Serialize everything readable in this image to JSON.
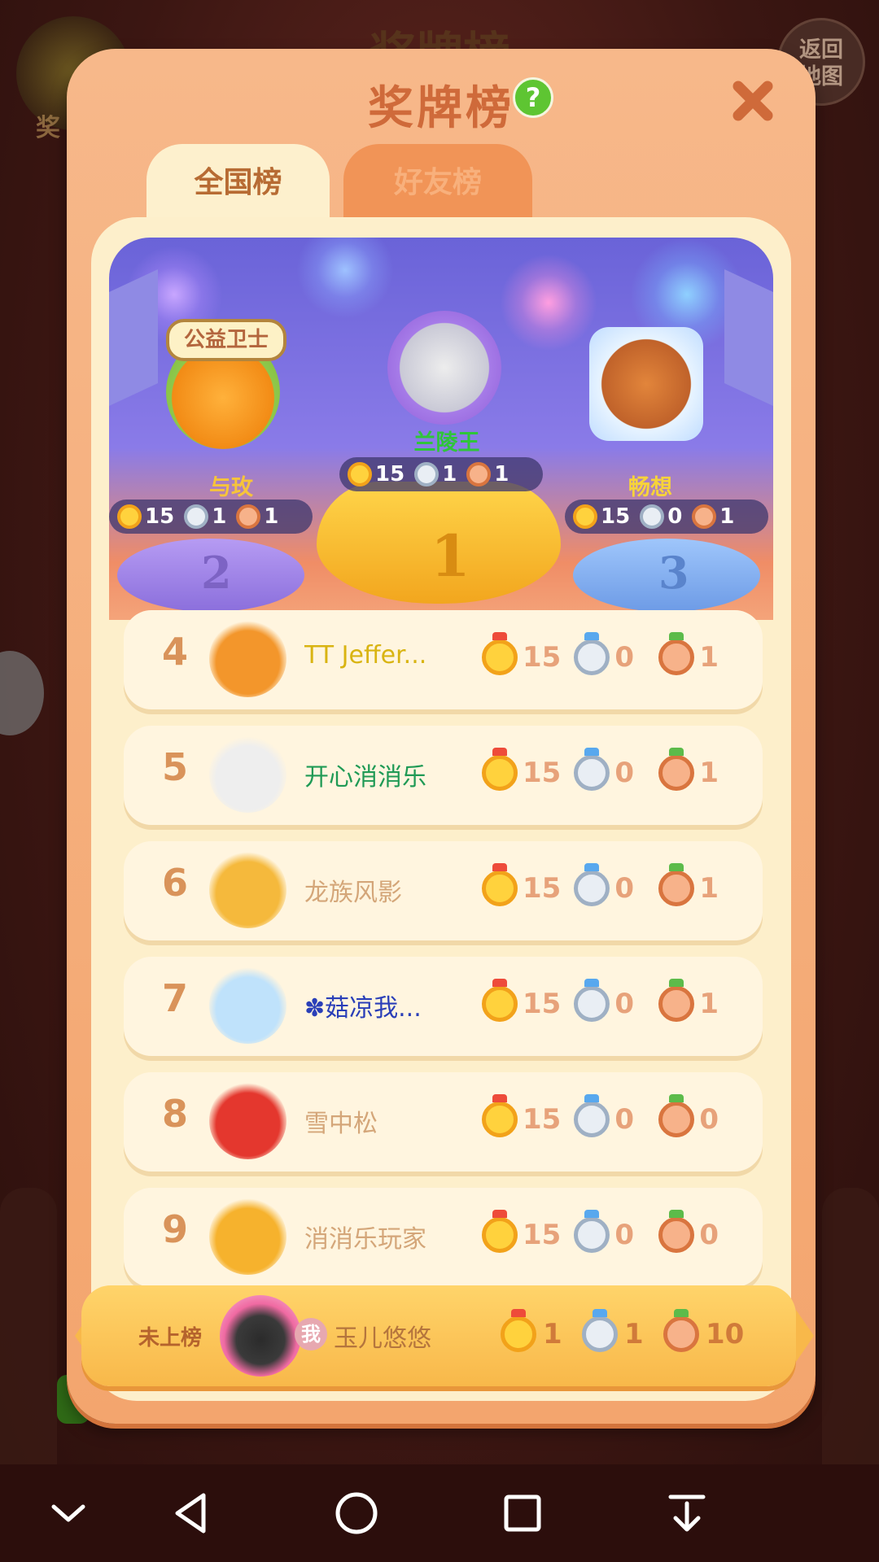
{
  "background": {
    "title": "奖牌榜",
    "left_label": "奖",
    "back_button": "返回\n地图"
  },
  "panel": {
    "title": "奖牌榜",
    "help_icon": "?",
    "close_icon": "close-icon"
  },
  "tabs": [
    {
      "label": "全国榜",
      "active": true
    },
    {
      "label": "好友榜",
      "active": false
    }
  ],
  "podium": [
    {
      "rank": "2",
      "name": "与玫",
      "badge": "公益卫士",
      "gold": "15",
      "silver": "1",
      "bronze": "1"
    },
    {
      "rank": "1",
      "name": "兰陵王",
      "gold": "15",
      "silver": "1",
      "bronze": "1"
    },
    {
      "rank": "3",
      "name": "畅想",
      "gold": "15",
      "silver": "0",
      "bronze": "1"
    }
  ],
  "list": [
    {
      "rank": "4",
      "name": "TT Jeffer...",
      "name_color": "#d9b412",
      "avatar_color": "#f3962b",
      "gold": "15",
      "silver": "0",
      "bronze": "1"
    },
    {
      "rank": "5",
      "name": "开心消消乐",
      "name_color": "#1f9a55",
      "avatar_color": "#eeeeee",
      "gold": "15",
      "silver": "0",
      "bronze": "1"
    },
    {
      "rank": "6",
      "name": "龙族风影",
      "name_color": "#d4a679",
      "avatar_color": "#f5b93c",
      "gold": "15",
      "silver": "0",
      "bronze": "1"
    },
    {
      "rank": "7",
      "name": "✽菇凉我...",
      "name_color": "#2a3fb8",
      "avatar_color": "#bfe2fb",
      "gold": "15",
      "silver": "0",
      "bronze": "1"
    },
    {
      "rank": "8",
      "name": "雪中松",
      "name_color": "#d4a679",
      "avatar_color": "#e4372e",
      "gold": "15",
      "silver": "0",
      "bronze": "0"
    },
    {
      "rank": "9",
      "name": "消消乐玩家",
      "name_color": "#d4a679",
      "avatar_color": "#f6b22d",
      "gold": "15",
      "silver": "0",
      "bronze": "0"
    }
  ],
  "self": {
    "rank_label": "未上榜",
    "me_badge": "我",
    "name": "玉儿悠悠",
    "gold": "1",
    "silver": "1",
    "bronze": "10"
  },
  "navbar": [
    "chevron-down-icon",
    "back-triangle-icon",
    "home-circle-icon",
    "recents-square-icon",
    "download-icon"
  ]
}
